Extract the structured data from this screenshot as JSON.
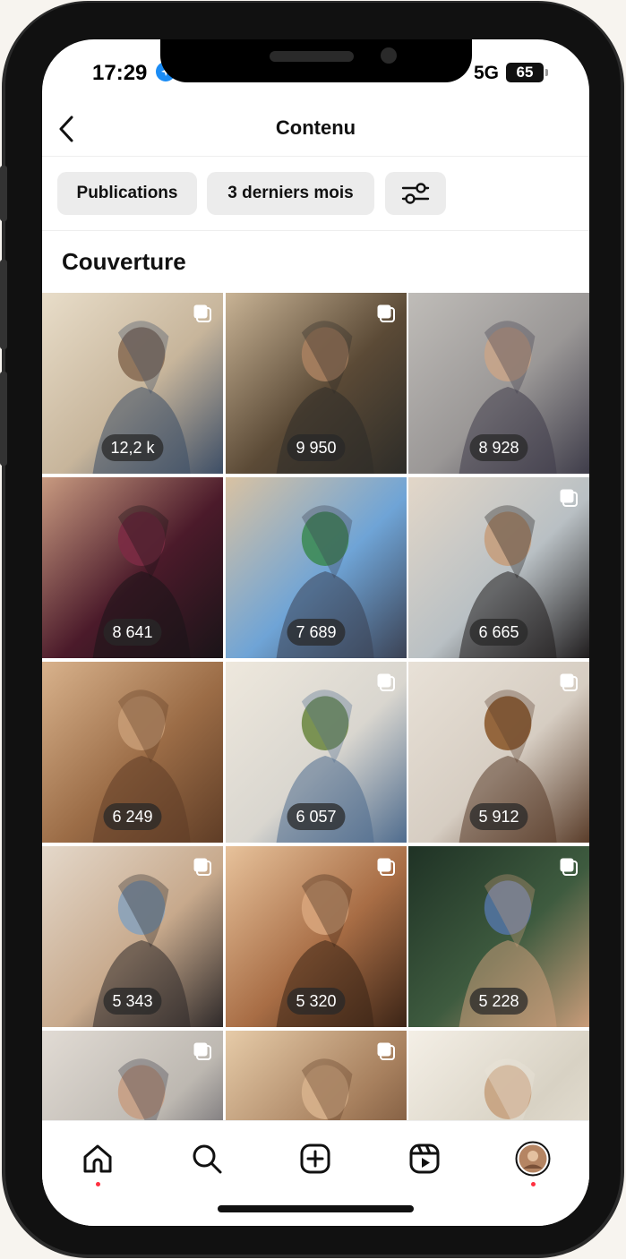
{
  "status": {
    "time": "17:29",
    "network": "5G",
    "battery": "65"
  },
  "header": {
    "title": "Contenu"
  },
  "filters": {
    "type_label": "Publications",
    "range_label": "3 derniers mois"
  },
  "section": {
    "title": "Couverture"
  },
  "grid": {
    "items": [
      {
        "value": "12,2 k",
        "multi": true,
        "palette": [
          "#c7b59b",
          "#8a6e55",
          "#3d4e66",
          "#e8ddc9"
        ]
      },
      {
        "value": "9 950",
        "multi": true,
        "palette": [
          "#5b4a36",
          "#a77f5f",
          "#2d2c28",
          "#c8b395"
        ]
      },
      {
        "value": "8 928",
        "multi": false,
        "palette": [
          "#9a9796",
          "#c6a48a",
          "#3f3d4a",
          "#bfbcb8"
        ]
      },
      {
        "value": "8 641",
        "multi": false,
        "palette": [
          "#4b1a2a",
          "#7b2b44",
          "#1a1418",
          "#c89a80"
        ]
      },
      {
        "value": "7 689",
        "multi": false,
        "palette": [
          "#6fa4d6",
          "#3e8b58",
          "#3b4254",
          "#d9c2a2"
        ]
      },
      {
        "value": "6 665",
        "multi": true,
        "palette": [
          "#b9c0c4",
          "#c59e7d",
          "#201d1e",
          "#e3d7c8"
        ]
      },
      {
        "value": "6 249",
        "multi": false,
        "palette": [
          "#9b6c46",
          "#c69b74",
          "#5f3d26",
          "#d8b28c"
        ]
      },
      {
        "value": "6 057",
        "multi": true,
        "palette": [
          "#d9d6cf",
          "#6f8a45",
          "#4f6c8e",
          "#eee8dd"
        ]
      },
      {
        "value": "5 912",
        "multi": true,
        "palette": [
          "#d6cdc2",
          "#8c5a2e",
          "#5a3d2a",
          "#e8e1d7"
        ]
      },
      {
        "value": "5 343",
        "multi": true,
        "palette": [
          "#c7a98c",
          "#8aa2ba",
          "#2f2a2a",
          "#e4d8ca"
        ]
      },
      {
        "value": "5 320",
        "multi": true,
        "palette": [
          "#a86d45",
          "#d7a47b",
          "#3b2416",
          "#e7c29b"
        ]
      },
      {
        "value": "5 228",
        "multi": true,
        "palette": [
          "#3e5b3f",
          "#5273a0",
          "#c99c7a",
          "#1f3225"
        ]
      },
      {
        "value": "",
        "multi": true,
        "palette": [
          "#bdb8b1",
          "#c79e84",
          "#3d3c48",
          "#e1dbd4"
        ]
      },
      {
        "value": "",
        "multi": true,
        "palette": [
          "#a7805e",
          "#d7b18c",
          "#5e3c26",
          "#e6cba8"
        ]
      },
      {
        "value": "",
        "multi": false,
        "palette": [
          "#d8d2c4",
          "#c7a27f",
          "#ece6da",
          "#f4efe6"
        ]
      }
    ]
  },
  "tabbar": {
    "items": [
      "home-icon",
      "search-icon",
      "create-icon",
      "reels-icon",
      "profile-avatar"
    ]
  },
  "colors": {
    "accent_dot": "#ff3040",
    "chip_bg": "#ececec"
  }
}
